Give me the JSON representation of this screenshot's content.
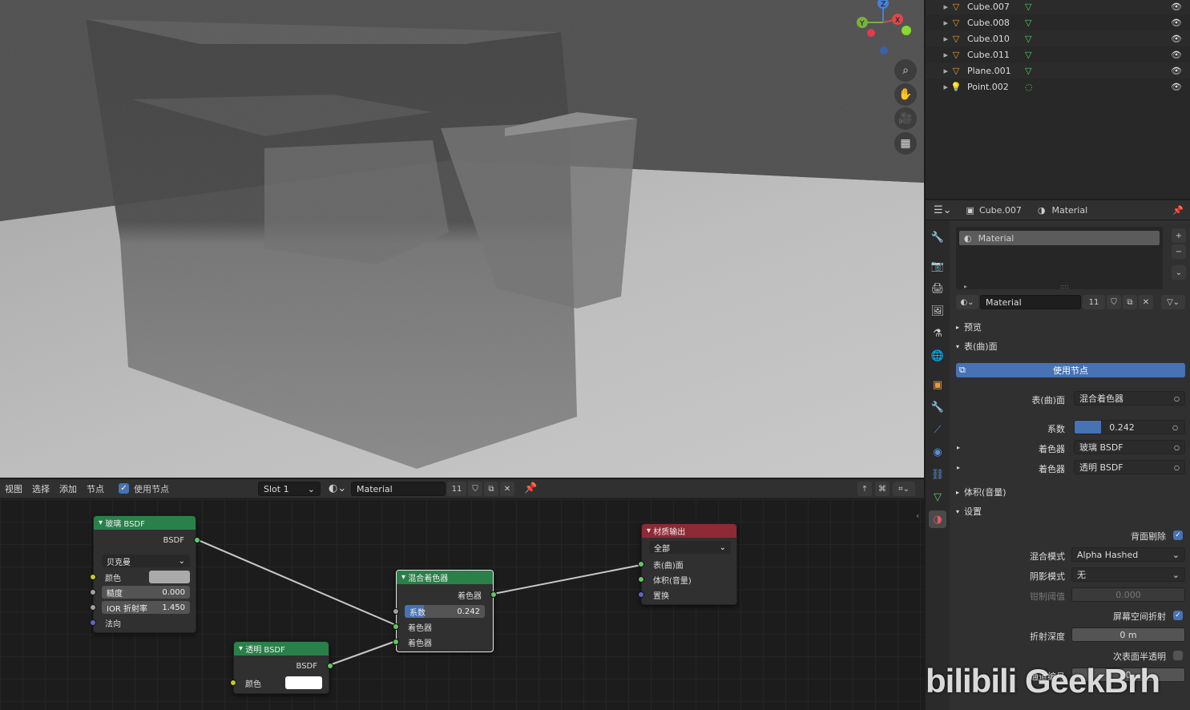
{
  "viewport": {
    "gizmo": {
      "x": "X",
      "y": "Y",
      "z": "Z"
    },
    "nav_icons": [
      "zoom-icon",
      "pan-hand-icon",
      "camera-icon",
      "grid-view-icon"
    ]
  },
  "node_editor": {
    "menu": [
      "视图",
      "选择",
      "添加",
      "节点"
    ],
    "use_nodes_label": "使用节点",
    "slot": "Slot 1",
    "material_name": "Material",
    "user_count": "11",
    "nodes": {
      "glass": {
        "title": "玻璃 BSDF",
        "output": "BSDF",
        "distribution": "贝克曼",
        "color_label": "颜色",
        "roughness_label": "糙度",
        "roughness_value": "0.000",
        "ior_label": "IOR 折射率",
        "ior_value": "1.450",
        "normal_label": "法向"
      },
      "transparent": {
        "title": "透明 BSDF",
        "output": "BSDF",
        "color_label": "颜色"
      },
      "mix": {
        "title": "混合着色器",
        "output": "着色器",
        "fac_label": "系数",
        "fac_value": "0.242",
        "fac_fraction": 0.242,
        "shader1": "着色器",
        "shader2": "着色器"
      },
      "output": {
        "title": "材质输出",
        "target": "全部",
        "surface": "表(曲)面",
        "volume": "体积(音量)",
        "displacement": "置换"
      }
    }
  },
  "outliner": {
    "items": [
      {
        "name": "Cube.007",
        "icon": "mesh-icon"
      },
      {
        "name": "Cube.008",
        "icon": "mesh-icon"
      },
      {
        "name": "Cube.010",
        "icon": "mesh-icon"
      },
      {
        "name": "Cube.011",
        "icon": "mesh-icon"
      },
      {
        "name": "Plane.001",
        "icon": "mesh-icon"
      },
      {
        "name": "Point.002",
        "icon": "light-icon"
      }
    ]
  },
  "properties": {
    "breadcrumb_object": "Cube.007",
    "breadcrumb_material": "Material",
    "slot_name": "Material",
    "material_name": "Material",
    "user_count": "11",
    "preview_label": "预览",
    "surface_label": "表(曲)面",
    "use_nodes_button": "使用节点",
    "surface_field_label": "表(曲)面",
    "surface_field_value": "混合着色器",
    "fac_label": "系数",
    "fac_value": "0.242",
    "fac_fraction": 0.242,
    "shader1_label": "着色器",
    "shader1_value": "玻璃 BSDF",
    "shader2_label": "着色器",
    "shader2_value": "透明 BSDF",
    "volume_label": "体积(音量)",
    "settings_label": "设置",
    "backface_culling_label": "背面剔除",
    "blend_mode_label": "混合模式",
    "blend_mode_value": "Alpha Hashed",
    "shadow_mode_label": "阴影模式",
    "shadow_mode_value": "无",
    "clip_threshold_label": "钳制阈值",
    "clip_threshold_value": "0.000",
    "ssr_label": "屏幕空间折射",
    "refraction_depth_label": "折射深度",
    "refraction_depth_value": "0 m",
    "sss_label": "次表面半透明",
    "pass_index_label": "通道编号",
    "pass_index_value": "0"
  },
  "watermark": "bilibili GeekBrh"
}
